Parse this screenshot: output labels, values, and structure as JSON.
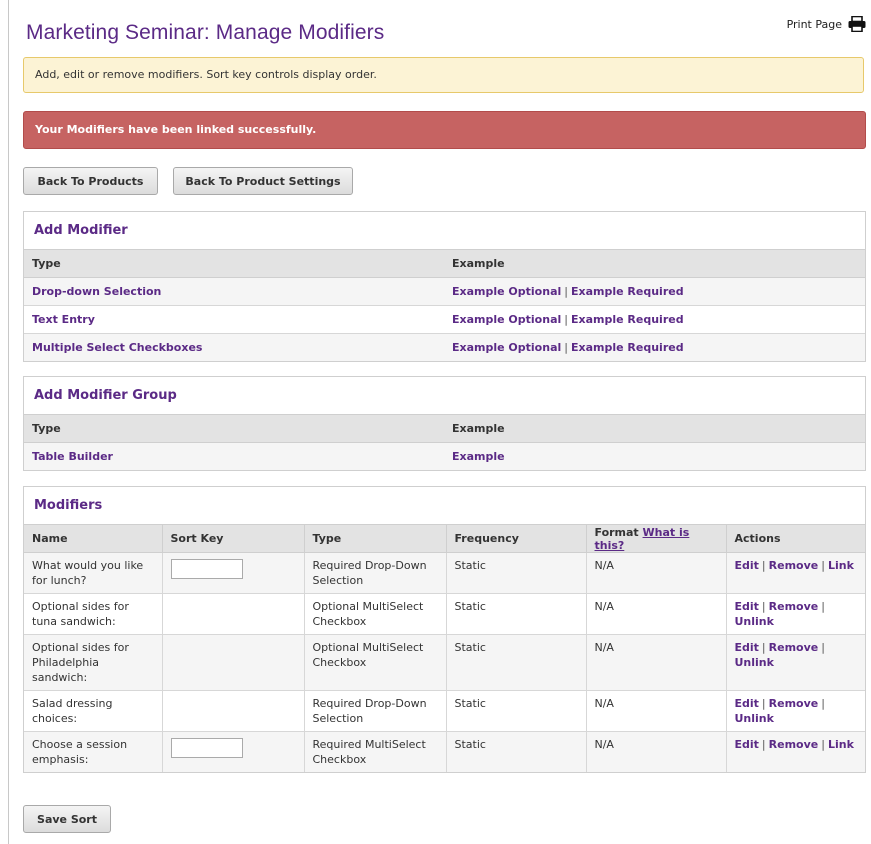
{
  "page": {
    "title": "Marketing Seminar: Manage Modifiers",
    "print_label": "Print Page",
    "info_text": "Add, edit or remove modifiers. Sort key controls display order.",
    "alert_text": "Your Modifiers have been linked successfully."
  },
  "buttons": {
    "back_products": "Back To Products",
    "back_settings": "Back To Product Settings",
    "save_sort": "Save Sort"
  },
  "add_modifier": {
    "title": "Add Modifier",
    "col_type": "Type",
    "col_example": "Example",
    "rows": [
      {
        "type": "Drop-down Selection",
        "opt": "Example Optional",
        "sep": "|",
        "req": "Example Required"
      },
      {
        "type": "Text Entry",
        "opt": "Example Optional",
        "sep": "|",
        "req": "Example Required"
      },
      {
        "type": "Multiple Select Checkboxes",
        "opt": "Example Optional",
        "sep": "|",
        "req": "Example Required"
      }
    ]
  },
  "add_group": {
    "title": "Add Modifier Group",
    "col_type": "Type",
    "col_example": "Example",
    "rows": [
      {
        "type": "Table Builder",
        "example": "Example"
      }
    ]
  },
  "modifiers": {
    "title": "Modifiers",
    "columns": {
      "name": "Name",
      "sort_key": "Sort Key",
      "type": "Type",
      "frequency": "Frequency",
      "format": "Format",
      "format_help": "What is this?",
      "actions": "Actions"
    },
    "action_labels": {
      "edit": "Edit",
      "remove": "Remove",
      "link": "Link",
      "unlink": "Unlink",
      "sep": "|"
    },
    "rows": [
      {
        "name": "What would you like for lunch?",
        "type": "Required Drop-Down Selection",
        "frequency": "Static",
        "format": "N/A"
      },
      {
        "name": "Optional sides for tuna sandwich:",
        "type": "Optional MultiSelect Checkbox",
        "frequency": "Static",
        "format": "N/A"
      },
      {
        "name": "Optional sides for Philadelphia sandwich:",
        "type": "Optional MultiSelect Checkbox",
        "frequency": "Static",
        "format": "N/A"
      },
      {
        "name": "Salad dressing choices:",
        "type": "Required Drop-Down Selection",
        "frequency": "Static",
        "format": "N/A"
      },
      {
        "name": "Choose a session emphasis:",
        "type": "Required MultiSelect Checkbox",
        "frequency": "Static",
        "format": "N/A"
      }
    ]
  },
  "colors": {
    "accent": "#5b2a86",
    "alert": "#c66362",
    "info_bg": "#fcf3d5"
  },
  "icons": {
    "print": "printer-icon"
  }
}
